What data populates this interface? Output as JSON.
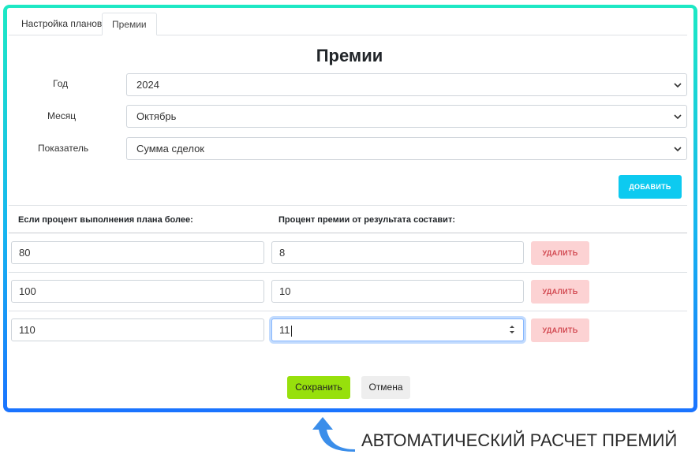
{
  "tabs": [
    {
      "label": "Настройка планов",
      "active": false
    },
    {
      "label": "Премии",
      "active": true
    }
  ],
  "page_title": "Премии",
  "form": {
    "year": {
      "label": "Год",
      "value": "2024"
    },
    "month": {
      "label": "Месяц",
      "value": "Октябрь"
    },
    "metric": {
      "label": "Показатель",
      "value": "Сумма сделок"
    }
  },
  "add_button": "ДОБАВИТЬ",
  "table": {
    "col_threshold": "Если процент выполнения плана более:",
    "col_bonus": "Процент премии от результата составит:",
    "delete_label": "УДАЛИТЬ",
    "rows": [
      {
        "threshold": "80",
        "bonus": "8"
      },
      {
        "threshold": "100",
        "bonus": "10"
      },
      {
        "threshold": "110",
        "bonus": "11"
      }
    ]
  },
  "save_button": "Сохранить",
  "cancel_button": "Отмена",
  "caption": "АВТОМАТИЧЕСКИЙ РАСЧЕТ ПРЕМИЙ",
  "colors": {
    "frame_top": "#1de9c4",
    "frame_bottom": "#1a73ff",
    "add_button": "#0dcaf0",
    "delete_button_bg": "#fcd2d3",
    "delete_button_text": "#d24a52",
    "save_button": "#97e00c",
    "arrow": "#3b8eea"
  }
}
